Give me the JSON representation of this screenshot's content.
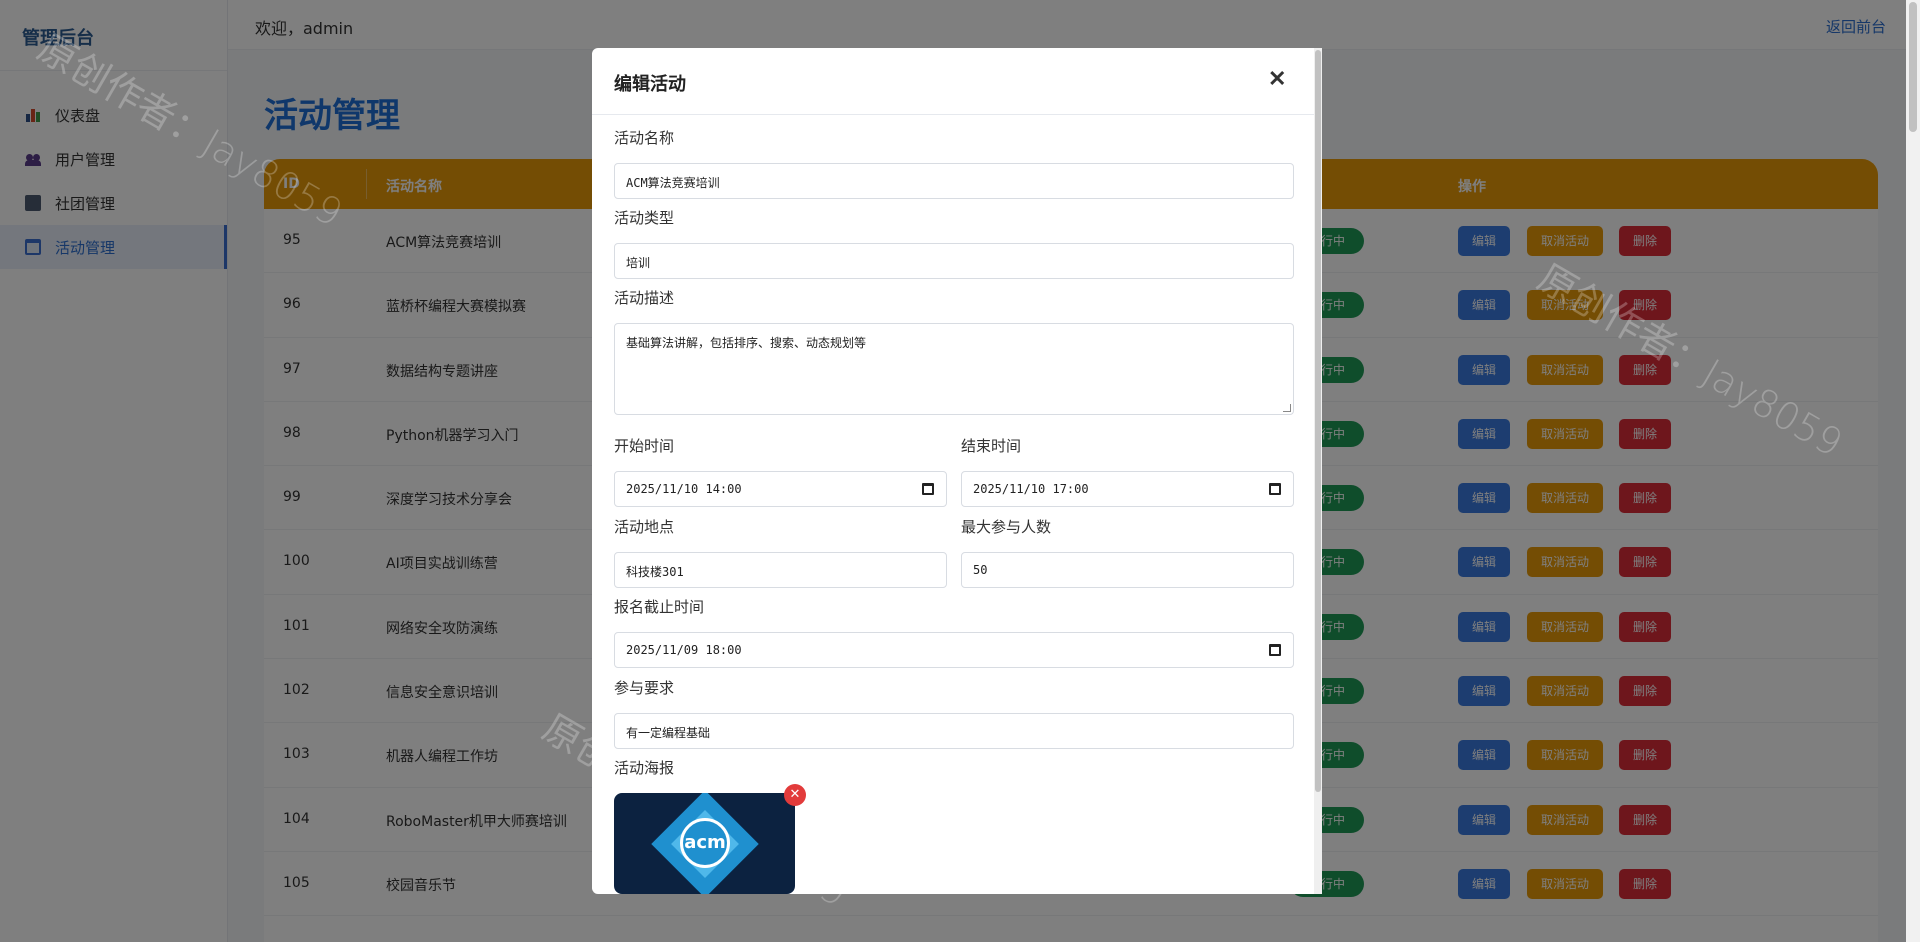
{
  "sidebar": {
    "brand": "管理后台",
    "items": [
      {
        "label": "仪表盘",
        "icon": "bar-chart-icon"
      },
      {
        "label": "用户管理",
        "icon": "users-icon"
      },
      {
        "label": "社团管理",
        "icon": "book-icon"
      },
      {
        "label": "活动管理",
        "icon": "calendar-icon",
        "active": true
      }
    ]
  },
  "topbar": {
    "welcome": "欢迎，admin",
    "return_link": "返回前台"
  },
  "page": {
    "title": "活动管理"
  },
  "table": {
    "headers": {
      "id": "ID",
      "name": "活动名称",
      "actions": "操作"
    },
    "status_label": "进行中",
    "status_color": "#1f9a57",
    "buttons": {
      "edit": "编辑",
      "cancel": "取消活动",
      "delete": "删除"
    },
    "rows": [
      {
        "id": "95",
        "name": "ACM算法竞赛培训"
      },
      {
        "id": "96",
        "name": "蓝桥杯编程大赛模拟赛"
      },
      {
        "id": "97",
        "name": "数据结构专题讲座"
      },
      {
        "id": "98",
        "name": "Python机器学习入门"
      },
      {
        "id": "99",
        "name": "深度学习技术分享会"
      },
      {
        "id": "100",
        "name": "AI项目实战训练营"
      },
      {
        "id": "101",
        "name": "网络安全攻防演练"
      },
      {
        "id": "102",
        "name": "信息安全意识培训"
      },
      {
        "id": "103",
        "name": "机器人编程工作坊"
      },
      {
        "id": "104",
        "name": "RoboMaster机甲大师赛培训"
      },
      {
        "id": "105",
        "name": "校园音乐节"
      }
    ]
  },
  "watermark": {
    "text": "原创作者：Jay8059"
  },
  "modal": {
    "title": "编辑活动",
    "close_icon": "close-icon",
    "fields": {
      "name": {
        "label": "活动名称",
        "value": "ACM算法竞赛培训"
      },
      "type": {
        "label": "活动类型",
        "value": "培训"
      },
      "description": {
        "label": "活动描述",
        "value": "基础算法讲解，包括排序、搜索、动态规划等"
      },
      "start_time": {
        "label": "开始时间",
        "value": "2025/11/10 14:00"
      },
      "end_time": {
        "label": "结束时间",
        "value": "2025/11/10 17:00"
      },
      "location": {
        "label": "活动地点",
        "value": "科技楼301"
      },
      "max_participants": {
        "label": "最大参与人数",
        "value": "50"
      },
      "deadline": {
        "label": "报名截止时间",
        "value": "2025/11/09 18:00"
      },
      "requirements": {
        "label": "参与要求",
        "value": "有一定编程基础"
      },
      "poster": {
        "label": "活动海报",
        "logo_text": "acm"
      }
    }
  },
  "colors": {
    "accent": "#1f6fd6",
    "table_header": "#e89a09",
    "edit": "#3a7be0",
    "cancel": "#e89a09",
    "delete": "#dc2c38"
  }
}
